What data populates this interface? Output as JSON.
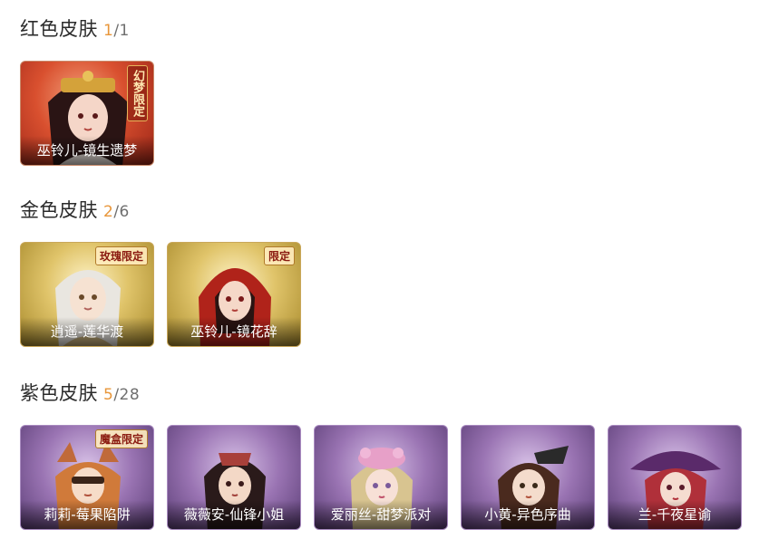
{
  "sections": [
    {
      "title": "红色皮肤",
      "owned": "1",
      "total": "/1",
      "skins": [
        {
          "name": "巫铃儿-镜生遗梦",
          "badge": "幻梦限定"
        }
      ]
    },
    {
      "title": "金色皮肤",
      "owned": "2",
      "total": "/6",
      "skins": [
        {
          "name": "逍遥-莲华渡",
          "badge": "玫瑰限定"
        },
        {
          "name": "巫铃儿-镜花辞",
          "badge": "限定"
        }
      ]
    },
    {
      "title": "紫色皮肤",
      "owned": "5",
      "total": "/28",
      "skins": [
        {
          "name": "莉莉-莓果陷阱",
          "badge": "魔盒限定"
        },
        {
          "name": "薇薇安-仙锋小姐",
          "badge": ""
        },
        {
          "name": "爱丽丝-甜梦派对",
          "badge": ""
        },
        {
          "name": "小黄-异色序曲",
          "badge": ""
        },
        {
          "name": "兰-千夜星谕",
          "badge": ""
        }
      ]
    }
  ],
  "colors": {
    "red_tier": "#d9502f",
    "gold_tier": "#e0c46a",
    "purple_tier": "#9a74b3",
    "owned_count": "#e8963a"
  }
}
